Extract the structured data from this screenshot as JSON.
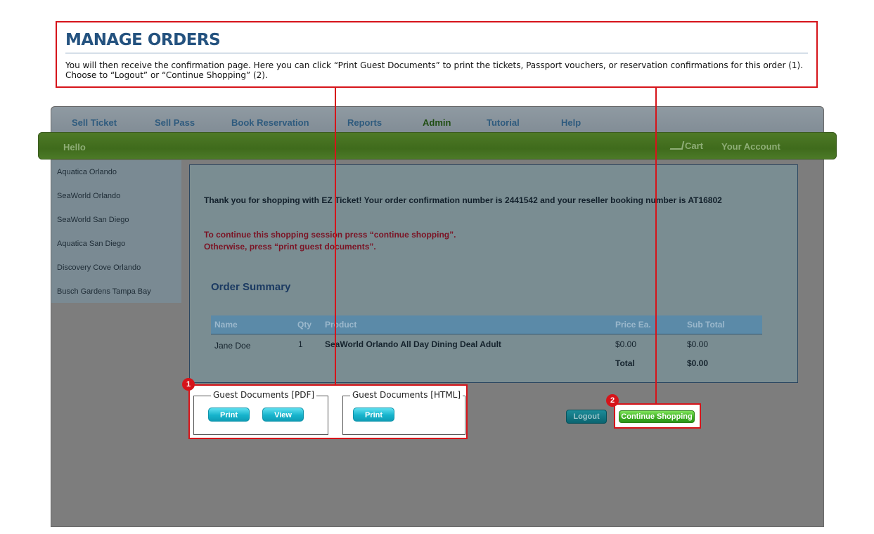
{
  "callout": {
    "title": "MANAGE ORDERS",
    "text": "You will then receive the confirmation page. Here you can click “Print Guest Documents” to print the tickets, Passport vouchers, or reservation confirmations for this order (1). Choose to “Logout” or “Continue Shopping” (2)."
  },
  "nav": {
    "items": [
      "Sell Ticket",
      "Sell Pass",
      "Book Reservation",
      "Reports",
      "Admin",
      "Tutorial",
      "Help"
    ]
  },
  "header": {
    "hello": "Hello",
    "cart": "Cart",
    "account": "Your Account"
  },
  "sidebar": {
    "items": [
      "Aquatica Orlando",
      "SeaWorld Orlando",
      "SeaWorld San Diego",
      "Aquatica San Diego",
      "Discovery Cove Orlando",
      "Busch Gardens Tampa Bay"
    ]
  },
  "confirmation": {
    "thanks": "Thank you for shopping with EZ Ticket! Your order confirmation number is 2441542 and your reseller booking number is AT16802",
    "continue_note": "To continue this shopping session press “continue shopping”.",
    "print_note": "Otherwise, press “print guest documents”."
  },
  "order_summary": {
    "title": "Order Summary",
    "columns": [
      "Name",
      "Qty",
      "Product",
      "Price Ea.",
      "Sub Total"
    ],
    "rows": [
      {
        "name": "Jane Doe",
        "qty": "1",
        "product": "SeaWorld Orlando All Day Dining Deal Adult",
        "price": "$0.00",
        "subtotal": "$0.00"
      }
    ],
    "total_label": "Total",
    "total_value": "$0.00"
  },
  "guest_documents": {
    "pdf_legend": "Guest Documents [PDF]",
    "html_legend": "Guest Documents [HTML]",
    "print_label": "Print",
    "view_label": "View"
  },
  "actions": {
    "logout": "Logout",
    "continue": "Continue Shopping"
  },
  "markers": [
    "1",
    "2"
  ],
  "colors": {
    "callout_border": "#d6141a",
    "title": "#24527f",
    "header_green": "#4a7a25",
    "aqua_button": "#17b4cc",
    "continue_green": "#3cae22"
  }
}
